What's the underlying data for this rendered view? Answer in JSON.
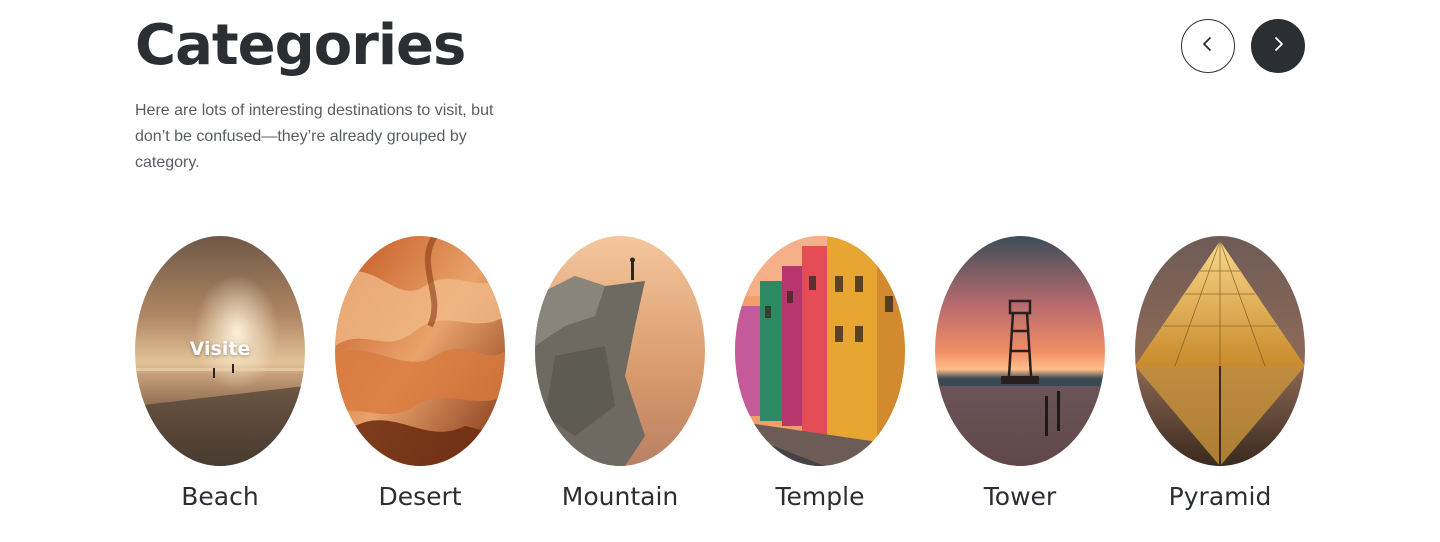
{
  "header": {
    "title": "Categories",
    "description": "Here are lots of interesting destinations to visit, but don’t be confused—they’re already grouped by category."
  },
  "navigation": {
    "prev_icon": "chevron-left-icon",
    "next_icon": "chevron-right-icon"
  },
  "categories": [
    {
      "label": "Beach",
      "overlay": "Visite",
      "image": "beach-sunset-photo"
    },
    {
      "label": "Desert",
      "image": "desert-canyon-photo"
    },
    {
      "label": "Mountain",
      "image": "mountain-cliff-photo"
    },
    {
      "label": "Temple",
      "image": "colorful-houses-photo"
    },
    {
      "label": "Tower",
      "image": "tower-sunset-photo"
    },
    {
      "label": "Pyramid",
      "image": "glass-pyramid-photo"
    }
  ],
  "colors": {
    "text": "#2b2e33",
    "muted": "#595d63",
    "button_dark": "#2b2e33",
    "background": "#ffffff"
  }
}
